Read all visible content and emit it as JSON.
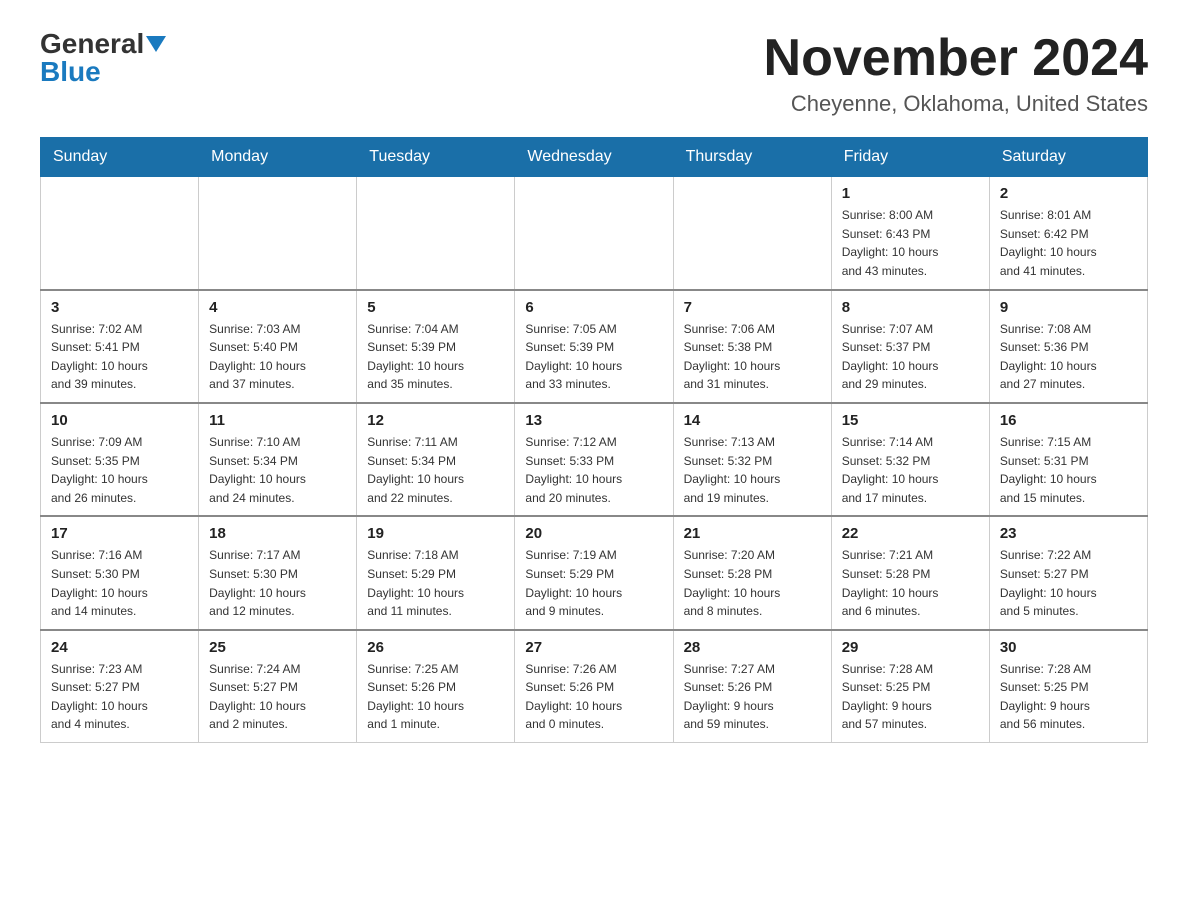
{
  "logo": {
    "general": "General",
    "blue": "Blue"
  },
  "title": "November 2024",
  "location": "Cheyenne, Oklahoma, United States",
  "days_of_week": [
    "Sunday",
    "Monday",
    "Tuesday",
    "Wednesday",
    "Thursday",
    "Friday",
    "Saturday"
  ],
  "weeks": [
    [
      {
        "day": "",
        "info": ""
      },
      {
        "day": "",
        "info": ""
      },
      {
        "day": "",
        "info": ""
      },
      {
        "day": "",
        "info": ""
      },
      {
        "day": "",
        "info": ""
      },
      {
        "day": "1",
        "info": "Sunrise: 8:00 AM\nSunset: 6:43 PM\nDaylight: 10 hours\nand 43 minutes."
      },
      {
        "day": "2",
        "info": "Sunrise: 8:01 AM\nSunset: 6:42 PM\nDaylight: 10 hours\nand 41 minutes."
      }
    ],
    [
      {
        "day": "3",
        "info": "Sunrise: 7:02 AM\nSunset: 5:41 PM\nDaylight: 10 hours\nand 39 minutes."
      },
      {
        "day": "4",
        "info": "Sunrise: 7:03 AM\nSunset: 5:40 PM\nDaylight: 10 hours\nand 37 minutes."
      },
      {
        "day": "5",
        "info": "Sunrise: 7:04 AM\nSunset: 5:39 PM\nDaylight: 10 hours\nand 35 minutes."
      },
      {
        "day": "6",
        "info": "Sunrise: 7:05 AM\nSunset: 5:39 PM\nDaylight: 10 hours\nand 33 minutes."
      },
      {
        "day": "7",
        "info": "Sunrise: 7:06 AM\nSunset: 5:38 PM\nDaylight: 10 hours\nand 31 minutes."
      },
      {
        "day": "8",
        "info": "Sunrise: 7:07 AM\nSunset: 5:37 PM\nDaylight: 10 hours\nand 29 minutes."
      },
      {
        "day": "9",
        "info": "Sunrise: 7:08 AM\nSunset: 5:36 PM\nDaylight: 10 hours\nand 27 minutes."
      }
    ],
    [
      {
        "day": "10",
        "info": "Sunrise: 7:09 AM\nSunset: 5:35 PM\nDaylight: 10 hours\nand 26 minutes."
      },
      {
        "day": "11",
        "info": "Sunrise: 7:10 AM\nSunset: 5:34 PM\nDaylight: 10 hours\nand 24 minutes."
      },
      {
        "day": "12",
        "info": "Sunrise: 7:11 AM\nSunset: 5:34 PM\nDaylight: 10 hours\nand 22 minutes."
      },
      {
        "day": "13",
        "info": "Sunrise: 7:12 AM\nSunset: 5:33 PM\nDaylight: 10 hours\nand 20 minutes."
      },
      {
        "day": "14",
        "info": "Sunrise: 7:13 AM\nSunset: 5:32 PM\nDaylight: 10 hours\nand 19 minutes."
      },
      {
        "day": "15",
        "info": "Sunrise: 7:14 AM\nSunset: 5:32 PM\nDaylight: 10 hours\nand 17 minutes."
      },
      {
        "day": "16",
        "info": "Sunrise: 7:15 AM\nSunset: 5:31 PM\nDaylight: 10 hours\nand 15 minutes."
      }
    ],
    [
      {
        "day": "17",
        "info": "Sunrise: 7:16 AM\nSunset: 5:30 PM\nDaylight: 10 hours\nand 14 minutes."
      },
      {
        "day": "18",
        "info": "Sunrise: 7:17 AM\nSunset: 5:30 PM\nDaylight: 10 hours\nand 12 minutes."
      },
      {
        "day": "19",
        "info": "Sunrise: 7:18 AM\nSunset: 5:29 PM\nDaylight: 10 hours\nand 11 minutes."
      },
      {
        "day": "20",
        "info": "Sunrise: 7:19 AM\nSunset: 5:29 PM\nDaylight: 10 hours\nand 9 minutes."
      },
      {
        "day": "21",
        "info": "Sunrise: 7:20 AM\nSunset: 5:28 PM\nDaylight: 10 hours\nand 8 minutes."
      },
      {
        "day": "22",
        "info": "Sunrise: 7:21 AM\nSunset: 5:28 PM\nDaylight: 10 hours\nand 6 minutes."
      },
      {
        "day": "23",
        "info": "Sunrise: 7:22 AM\nSunset: 5:27 PM\nDaylight: 10 hours\nand 5 minutes."
      }
    ],
    [
      {
        "day": "24",
        "info": "Sunrise: 7:23 AM\nSunset: 5:27 PM\nDaylight: 10 hours\nand 4 minutes."
      },
      {
        "day": "25",
        "info": "Sunrise: 7:24 AM\nSunset: 5:27 PM\nDaylight: 10 hours\nand 2 minutes."
      },
      {
        "day": "26",
        "info": "Sunrise: 7:25 AM\nSunset: 5:26 PM\nDaylight: 10 hours\nand 1 minute."
      },
      {
        "day": "27",
        "info": "Sunrise: 7:26 AM\nSunset: 5:26 PM\nDaylight: 10 hours\nand 0 minutes."
      },
      {
        "day": "28",
        "info": "Sunrise: 7:27 AM\nSunset: 5:26 PM\nDaylight: 9 hours\nand 59 minutes."
      },
      {
        "day": "29",
        "info": "Sunrise: 7:28 AM\nSunset: 5:25 PM\nDaylight: 9 hours\nand 57 minutes."
      },
      {
        "day": "30",
        "info": "Sunrise: 7:28 AM\nSunset: 5:25 PM\nDaylight: 9 hours\nand 56 minutes."
      }
    ]
  ]
}
